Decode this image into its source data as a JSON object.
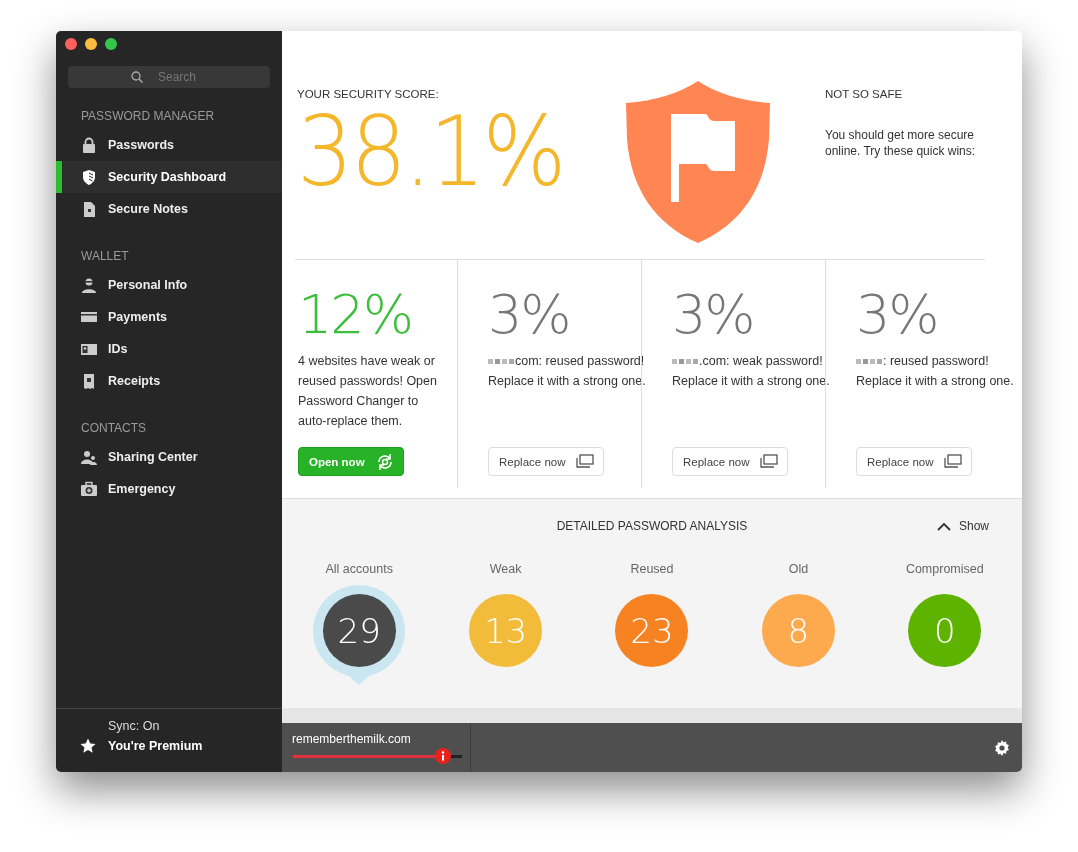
{
  "sidebar": {
    "search": {
      "placeholder": "Search"
    },
    "sections": [
      {
        "title": "PASSWORD MANAGER",
        "items": [
          {
            "label": "Passwords",
            "selected": false
          },
          {
            "label": "Security Dashboard",
            "selected": true
          },
          {
            "label": "Secure Notes",
            "selected": false
          }
        ]
      },
      {
        "title": "WALLET",
        "items": [
          {
            "label": "Personal Info",
            "selected": false
          },
          {
            "label": "Payments",
            "selected": false
          },
          {
            "label": "IDs",
            "selected": false
          },
          {
            "label": "Receipts",
            "selected": false
          }
        ]
      },
      {
        "title": "CONTACTS",
        "items": [
          {
            "label": "Sharing Center",
            "selected": false
          },
          {
            "label": "Emergency",
            "selected": false
          }
        ]
      }
    ],
    "sync": "Sync: On",
    "premium": "You're Premium"
  },
  "score": {
    "label": "YOUR SECURITY SCORE:",
    "value": "38.1%",
    "status": "NOT SO SAFE",
    "message": "You should get more secure online. Try these quick wins:"
  },
  "quick_wins": [
    {
      "kind": "changer",
      "percent": "12%",
      "text": "4 websites have weak or reused passwords! Open Password Changer to auto-replace them.",
      "button": "Open now"
    },
    {
      "kind": "replace",
      "percent": "3%",
      "text": "com: reused password! Replace it with a strong one.",
      "button": "Replace now"
    },
    {
      "kind": "replace",
      "percent": "3%",
      "text": ".com: weak password! Replace it with a strong one.",
      "button": "Replace now"
    },
    {
      "kind": "replace",
      "percent": "3%",
      "text": ": reused password! Replace it with a strong one.",
      "button": "Replace now"
    }
  ],
  "analysis": {
    "title": "DETAILED PASSWORD ANALYSIS",
    "toggle": "Show",
    "categories": [
      {
        "label": "All accounts",
        "count": "29",
        "color": "#4a4a4a",
        "selected": true
      },
      {
        "label": "Weak",
        "count": "13",
        "color": "#f2bc3a",
        "selected": false
      },
      {
        "label": "Reused",
        "count": "23",
        "color": "#f78222",
        "selected": false
      },
      {
        "label": "Old",
        "count": "8",
        "color": "#fdaa4f",
        "selected": false
      },
      {
        "label": "Compromised",
        "count": "0",
        "color": "#5db300",
        "selected": false
      }
    ]
  },
  "bottom_bar": {
    "site": "rememberthemilk.com",
    "strength": {
      "level": 0.89
    }
  }
}
